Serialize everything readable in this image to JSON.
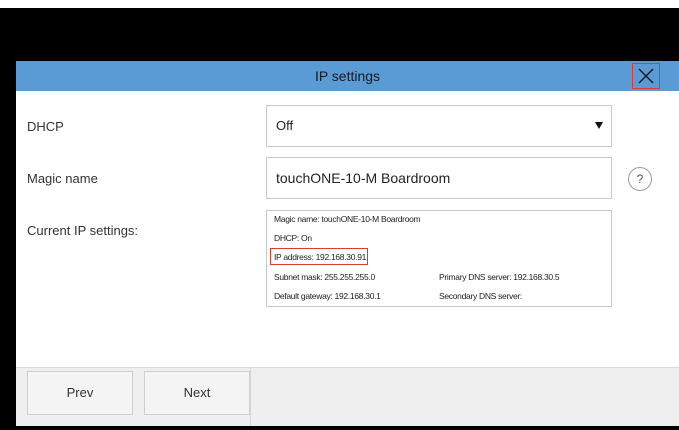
{
  "dialog": {
    "title": "IP settings",
    "close_icon": "close-icon"
  },
  "rows": {
    "dhcp": {
      "label": "DHCP",
      "value": "Off",
      "arrow_icon": "dropdown-arrow-icon"
    },
    "magic_name": {
      "label": "Magic name",
      "value": "touchONE-10-M Boardroom",
      "help_label": "?"
    },
    "current": {
      "label": "Current IP settings:"
    }
  },
  "current_ip": {
    "magic_name": "Magic name: touchONE-10-M Boardroom",
    "dhcp": "DHCP: On",
    "ip_address": "IP address: 192.168.30.91",
    "subnet_mask": "Subnet mask: 255.255.255.0",
    "default_gateway": "Default gateway: 192.168.30.1",
    "primary_dns": "Primary DNS server: 192.168.30.5",
    "secondary_dns": "Secondary DNS server:"
  },
  "footer": {
    "prev_label": "Prev",
    "next_label": "Next"
  },
  "colors": {
    "titlebar": "#5b9bd5",
    "highlight": "#e0392f",
    "frame": "#000000"
  }
}
